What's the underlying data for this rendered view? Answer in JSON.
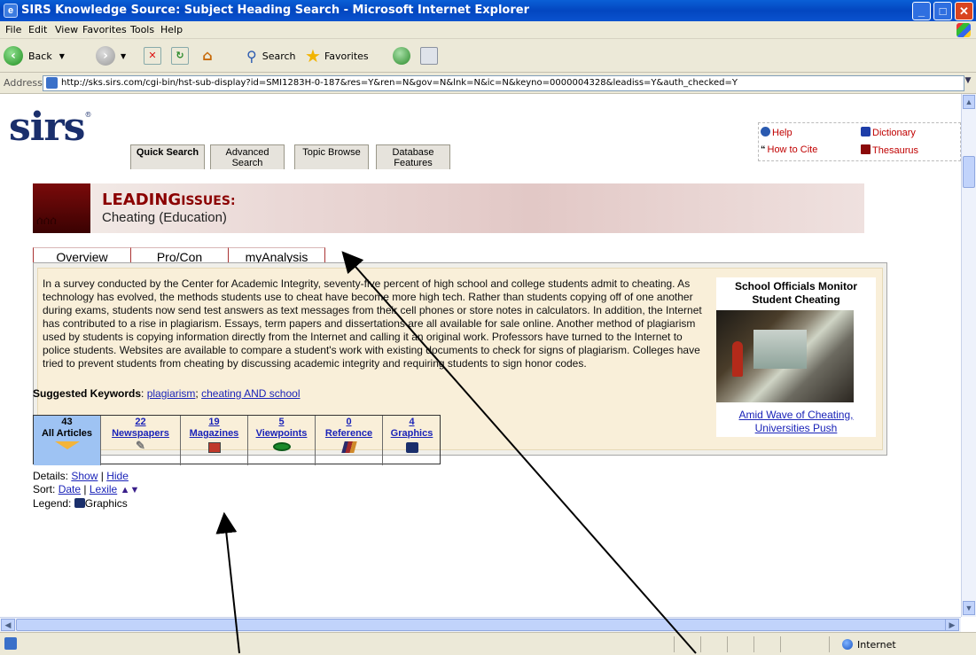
{
  "window": {
    "title": "SIRS Knowledge Source: Subject Heading Search - Microsoft Internet Explorer",
    "minimize": "_",
    "maximize": "□",
    "close": "✕"
  },
  "menu": {
    "items": [
      "File",
      "Edit",
      "View",
      "Favorites",
      "Tools",
      "Help"
    ]
  },
  "toolbar": {
    "back": "Back",
    "search": "Search",
    "favorites": "Favorites"
  },
  "address": {
    "label": "Address",
    "url": "http://sks.sirs.com/cgi-bin/hst-sub-display?id=SMI1283H-0-187&res=Y&ren=N&gov=N&lnk=N&ic=N&keyno=0000004328&leadiss=Y&auth_checked=Y"
  },
  "sirs": {
    "logo": "sirs",
    "logo_mark": "®",
    "nav_tabs": [
      {
        "label": "Quick Search"
      },
      {
        "label": "Advanced Search"
      },
      {
        "label": "Topic Browse"
      },
      {
        "label": "Database Features"
      }
    ],
    "help": {
      "help": "Help",
      "dictionary": "Dictionary",
      "cite": "How to Cite",
      "thesaurus": "Thesaurus"
    }
  },
  "banner": {
    "brand_leading": "LEADING",
    "brand_issues": "ISSUES:",
    "topic": "Cheating (Education)"
  },
  "subtabs": [
    "Overview",
    "Pro/Con",
    "myAnalysis"
  ],
  "overview": {
    "text": "In a survey conducted by the Center for Academic Integrity, seventy-five percent of high school and college students admit to cheating. As technology has evolved, the methods students use to cheat have become more high tech. Rather than students copying off of one another during exams, students now send test answers as text messages from their cell phones or store notes in calculators. In addition, the Internet has contributed to a rise in plagiarism. Essays, term papers and dissertations are all available for sale online. Another method of plagiarism used by students is copying information directly from the Internet and calling it an original work. Professors have turned to the Internet to police students. Websites are available to compare a student's work with existing documents to check for signs of plagiarism. Colleges have tried to prevent students from cheating by discussing academic integrity and requiring students to sign honor codes.",
    "sidebar_title": "School Officials Monitor Student Cheating",
    "sidebar_link": "Amid Wave of Cheating, Universities Push"
  },
  "keywords": {
    "label": "Suggested Keywords",
    "colon": ":",
    "k1": "plagiarism",
    "sep": ";",
    "k2": "cheating AND school"
  },
  "counts": [
    {
      "n": "43",
      "label": "All Articles",
      "icon": "down-arrow-icon",
      "color": "#f3b43a"
    },
    {
      "n": "22",
      "label": "Newspapers",
      "icon": "pencil-icon",
      "color": "#888888"
    },
    {
      "n": "19",
      "label": "Magazines",
      "icon": "magazine-icon",
      "color": "#c0392b"
    },
    {
      "n": "5",
      "label": "Viewpoints",
      "icon": "eye-icon",
      "color": "#1a8a2a"
    },
    {
      "n": "0",
      "label": "Reference",
      "icon": "books-icon",
      "color": "#a0292b"
    },
    {
      "n": "4",
      "label": "Graphics",
      "icon": "camera-icon",
      "color": "#1a2f6c"
    }
  ],
  "details": {
    "details_label": "Details:",
    "show": "Show",
    "bar": "|",
    "hide": "Hide",
    "sort_label": "Sort:",
    "date": "Date",
    "lexile": "Lexile",
    "legend_label": "Legend:",
    "legend_graphics": "Graphics"
  },
  "status": {
    "zone": "Internet"
  }
}
